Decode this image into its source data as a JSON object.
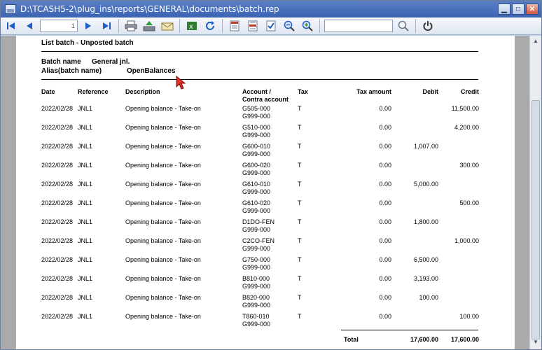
{
  "window": {
    "title": "D:\\TCASH5-2\\plug_ins\\reports\\GENERAL\\documents\\batch.rep",
    "minimize": "▁",
    "maximize": "□",
    "close": "✕"
  },
  "toolbar": {
    "page_value": "1",
    "search_value": "",
    "buttons": [
      "first-page",
      "prev-page",
      "next-page",
      "last-page",
      "print",
      "export",
      "email",
      "excel",
      "refresh",
      "layout-1",
      "layout-2",
      "layout-3",
      "zoom-out",
      "zoom-in",
      "search",
      "power"
    ]
  },
  "report": {
    "title": "List batch -  Unposted batch",
    "batch_name_label": "Batch name",
    "batch_name_value": "General jnl.",
    "alias_label": "Alias(batch name)",
    "alias_value": "OpenBalances",
    "columns": {
      "date": "Date",
      "reference": "Reference",
      "description": "Description",
      "account": "Account /",
      "contra": "Contra account",
      "tax": "Tax",
      "tax_amount": "Tax amount",
      "debit": "Debit",
      "credit": "Credit"
    },
    "rows": [
      {
        "date": "2022/02/28",
        "ref": "JNL1",
        "desc": "Opening balance - Take-on",
        "acc": "G505-000",
        "contra": "G999-000",
        "tax": "T",
        "taxamt": "0.00",
        "debit": "",
        "credit": "11,500.00"
      },
      {
        "date": "2022/02/28",
        "ref": "JNL1",
        "desc": "Opening balance - Take-on",
        "acc": "G510-000",
        "contra": "G999-000",
        "tax": "T",
        "taxamt": "0.00",
        "debit": "",
        "credit": "4,200.00"
      },
      {
        "date": "2022/02/28",
        "ref": "JNL1",
        "desc": "Opening balance - Take-on",
        "acc": "G600-010",
        "contra": "G999-000",
        "tax": "T",
        "taxamt": "0.00",
        "debit": "1,007.00",
        "credit": ""
      },
      {
        "date": "2022/02/28",
        "ref": "JNL1",
        "desc": "Opening balance - Take-on",
        "acc": "G600-020",
        "contra": "G999-000",
        "tax": "T",
        "taxamt": "0.00",
        "debit": "",
        "credit": "300.00"
      },
      {
        "date": "2022/02/28",
        "ref": "JNL1",
        "desc": "Opening balance - Take-on",
        "acc": "G610-010",
        "contra": "G999-000",
        "tax": "T",
        "taxamt": "0.00",
        "debit": "5,000.00",
        "credit": ""
      },
      {
        "date": "2022/02/28",
        "ref": "JNL1",
        "desc": "Opening balance - Take-on",
        "acc": "G610-020",
        "contra": "G999-000",
        "tax": "T",
        "taxamt": "0.00",
        "debit": "",
        "credit": "500.00"
      },
      {
        "date": "2022/02/28",
        "ref": "JNL1",
        "desc": "Opening balance - Take-on",
        "acc": "D1DO-FEN",
        "contra": "G999-000",
        "tax": "T",
        "taxamt": "0.00",
        "debit": "1,800.00",
        "credit": ""
      },
      {
        "date": "2022/02/28",
        "ref": "JNL1",
        "desc": "Opening balance - Take-on",
        "acc": "C2CO-FEN",
        "contra": "G999-000",
        "tax": "T",
        "taxamt": "0.00",
        "debit": "",
        "credit": "1,000.00"
      },
      {
        "date": "2022/02/28",
        "ref": "JNL1",
        "desc": "Opening balance - Take-on",
        "acc": "G750-000",
        "contra": "G999-000",
        "tax": "T",
        "taxamt": "0.00",
        "debit": "6,500.00",
        "credit": ""
      },
      {
        "date": "2022/02/28",
        "ref": "JNL1",
        "desc": "Opening balance - Take-on",
        "acc": "B810-000",
        "contra": "G999-000",
        "tax": "T",
        "taxamt": "0.00",
        "debit": "3,193.00",
        "credit": ""
      },
      {
        "date": "2022/02/28",
        "ref": "JNL1",
        "desc": "Opening balance - Take-on",
        "acc": "B820-000",
        "contra": "G999-000",
        "tax": "T",
        "taxamt": "0.00",
        "debit": "100.00",
        "credit": ""
      },
      {
        "date": "2022/02/28",
        "ref": "JNL1",
        "desc": "Opening balance - Take-on",
        "acc": "T860-010",
        "contra": "G999-000",
        "tax": "T",
        "taxamt": "0.00",
        "debit": "",
        "credit": "100.00"
      }
    ],
    "total_label": "Total",
    "total_debit": "17,600.00",
    "total_credit": "17,600.00"
  },
  "colors": {
    "title_bar": "#3a63b3",
    "accent": "#1f5fbf",
    "viewer_bg": "#aaaaaa",
    "cursor": "#e0302a"
  }
}
